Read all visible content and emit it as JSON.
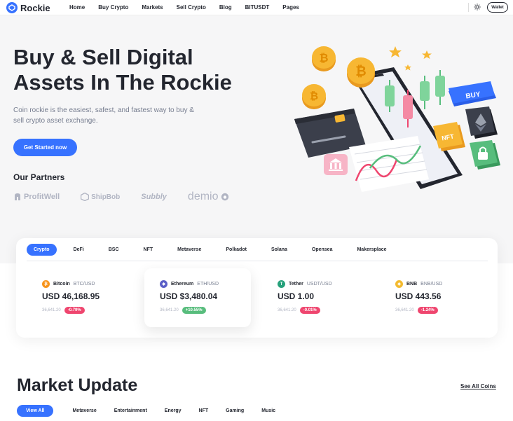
{
  "header": {
    "logo_text": "Rockie",
    "nav": [
      "Home",
      "Buy Crypto",
      "Markets",
      "Sell Crypto",
      "Blog",
      "BITUSDT",
      "Pages"
    ],
    "wallet_label": "Wallet"
  },
  "hero": {
    "title": "Buy & Sell Digital Assets In The Rockie",
    "description": "Coin rockie is the easiest, safest, and fastest way to buy & sell crypto asset exchange.",
    "cta_label": "Get Started now",
    "partners_title": "Our Partners",
    "partners": [
      "ProfitWell",
      "ShipBob",
      "Subbly",
      "demio"
    ],
    "art_labels": {
      "buy": "BUY",
      "nft": "NFT"
    }
  },
  "crypto": {
    "tabs": [
      "Crypto",
      "DeFi",
      "BSC",
      "NFT",
      "Metaverse",
      "Polkadot",
      "Solana",
      "Opensea",
      "Makersplace"
    ],
    "active_tab": "Crypto",
    "coins": [
      {
        "name": "Bitcoin",
        "pair": "BTC/USD",
        "price": "USD 46,168.95",
        "volume": "36,641.20",
        "change": "-0.79%",
        "trend": "down",
        "icon_color": "#f7931a",
        "icon": "bitcoin-icon"
      },
      {
        "name": "Ethereum",
        "pair": "ETH/USD",
        "price": "USD $3,480.04",
        "volume": "36,641.20",
        "change": "+10.55%",
        "trend": "up",
        "icon_color": "#5b5fc7",
        "icon": "ethereum-icon"
      },
      {
        "name": "Tether",
        "pair": "USDT/USD",
        "price": "USD 1.00",
        "volume": "36,641.20",
        "change": "-0.01%",
        "trend": "down",
        "icon_color": "#26a17b",
        "icon": "tether-icon"
      },
      {
        "name": "BNB",
        "pair": "BNB/USD",
        "price": "USD 443.56",
        "volume": "36,641.20",
        "change": "-1.24%",
        "trend": "down",
        "icon_color": "#f3ba2f",
        "icon": "bnb-icon"
      }
    ]
  },
  "market": {
    "title": "Market Update",
    "see_all": "See All Coins",
    "tabs": [
      "View All",
      "Metaverse",
      "Entertainment",
      "Energy",
      "NFT",
      "Gaming",
      "Music"
    ],
    "active_tab": "View All"
  },
  "colors": {
    "accent": "#3772ff",
    "red": "#ef466f",
    "green": "#58bd7d"
  }
}
